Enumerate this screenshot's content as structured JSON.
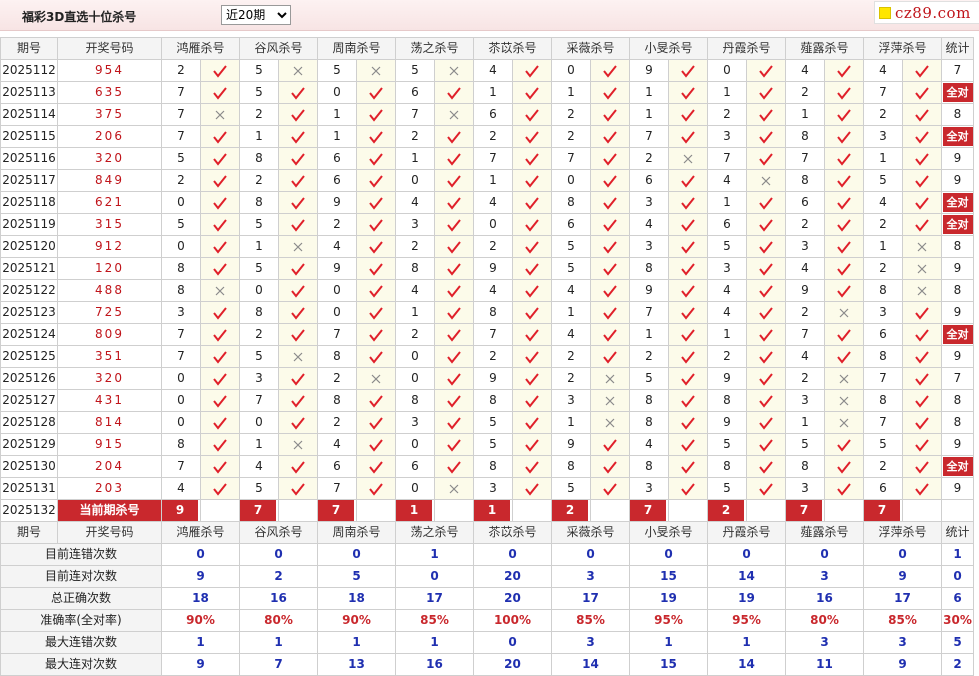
{
  "header": {
    "title": "福彩3D直选十位杀号",
    "period_selected": "近20期",
    "period_options": [
      "近20期"
    ],
    "logo_text": "cz89.com"
  },
  "columns": {
    "issue": "期号",
    "code": "开奖号码",
    "experts": [
      "鸿雁杀号",
      "谷风杀号",
      "周南杀号",
      "荡之杀号",
      "苶苡杀号",
      "采薇杀号",
      "小旻杀号",
      "丹霞杀号",
      "薤露杀号",
      "浮萍杀号"
    ],
    "total": "统计"
  },
  "rows": [
    {
      "issue": "2025112",
      "code": "954",
      "kills": [
        [
          2,
          1
        ],
        [
          5,
          0
        ],
        [
          5,
          0
        ],
        [
          5,
          0
        ],
        [
          4,
          1
        ],
        [
          0,
          1
        ],
        [
          9,
          1
        ],
        [
          0,
          1
        ],
        [
          4,
          1
        ],
        [
          4,
          1
        ]
      ],
      "total": "7"
    },
    {
      "issue": "2025113",
      "code": "635",
      "kills": [
        [
          7,
          1
        ],
        [
          5,
          1
        ],
        [
          0,
          1
        ],
        [
          6,
          1
        ],
        [
          1,
          1
        ],
        [
          1,
          1
        ],
        [
          1,
          1
        ],
        [
          1,
          1
        ],
        [
          2,
          1
        ],
        [
          7,
          1
        ]
      ],
      "total": "全对"
    },
    {
      "issue": "2025114",
      "code": "375",
      "kills": [
        [
          7,
          0
        ],
        [
          2,
          1
        ],
        [
          1,
          1
        ],
        [
          7,
          0
        ],
        [
          6,
          1
        ],
        [
          2,
          1
        ],
        [
          1,
          1
        ],
        [
          2,
          1
        ],
        [
          1,
          1
        ],
        [
          2,
          1
        ]
      ],
      "total": "8"
    },
    {
      "issue": "2025115",
      "code": "206",
      "kills": [
        [
          7,
          1
        ],
        [
          1,
          1
        ],
        [
          1,
          1
        ],
        [
          2,
          1
        ],
        [
          2,
          1
        ],
        [
          2,
          1
        ],
        [
          7,
          1
        ],
        [
          3,
          1
        ],
        [
          8,
          1
        ],
        [
          3,
          1
        ]
      ],
      "total": "全对"
    },
    {
      "issue": "2025116",
      "code": "320",
      "kills": [
        [
          5,
          1
        ],
        [
          8,
          1
        ],
        [
          6,
          1
        ],
        [
          1,
          1
        ],
        [
          7,
          1
        ],
        [
          7,
          1
        ],
        [
          2,
          0
        ],
        [
          7,
          1
        ],
        [
          7,
          1
        ],
        [
          1,
          1
        ]
      ],
      "total": "9"
    },
    {
      "issue": "2025117",
      "code": "849",
      "kills": [
        [
          2,
          1
        ],
        [
          2,
          1
        ],
        [
          6,
          1
        ],
        [
          0,
          1
        ],
        [
          1,
          1
        ],
        [
          0,
          1
        ],
        [
          6,
          1
        ],
        [
          4,
          0
        ],
        [
          8,
          1
        ],
        [
          5,
          1
        ]
      ],
      "total": "9"
    },
    {
      "issue": "2025118",
      "code": "621",
      "kills": [
        [
          0,
          1
        ],
        [
          8,
          1
        ],
        [
          9,
          1
        ],
        [
          4,
          1
        ],
        [
          4,
          1
        ],
        [
          8,
          1
        ],
        [
          3,
          1
        ],
        [
          1,
          1
        ],
        [
          6,
          1
        ],
        [
          4,
          1
        ]
      ],
      "total": "全对"
    },
    {
      "issue": "2025119",
      "code": "315",
      "kills": [
        [
          5,
          1
        ],
        [
          5,
          1
        ],
        [
          2,
          1
        ],
        [
          3,
          1
        ],
        [
          0,
          1
        ],
        [
          6,
          1
        ],
        [
          4,
          1
        ],
        [
          6,
          1
        ],
        [
          2,
          1
        ],
        [
          2,
          1
        ]
      ],
      "total": "全对"
    },
    {
      "issue": "2025120",
      "code": "912",
      "kills": [
        [
          0,
          1
        ],
        [
          1,
          0
        ],
        [
          4,
          1
        ],
        [
          2,
          1
        ],
        [
          2,
          1
        ],
        [
          5,
          1
        ],
        [
          3,
          1
        ],
        [
          5,
          1
        ],
        [
          3,
          1
        ],
        [
          1,
          0
        ]
      ],
      "total": "8"
    },
    {
      "issue": "2025121",
      "code": "120",
      "kills": [
        [
          8,
          1
        ],
        [
          5,
          1
        ],
        [
          9,
          1
        ],
        [
          8,
          1
        ],
        [
          9,
          1
        ],
        [
          5,
          1
        ],
        [
          8,
          1
        ],
        [
          3,
          1
        ],
        [
          4,
          1
        ],
        [
          2,
          0
        ]
      ],
      "total": "9"
    },
    {
      "issue": "2025122",
      "code": "488",
      "kills": [
        [
          8,
          0
        ],
        [
          0,
          1
        ],
        [
          0,
          1
        ],
        [
          4,
          1
        ],
        [
          4,
          1
        ],
        [
          4,
          1
        ],
        [
          9,
          1
        ],
        [
          4,
          1
        ],
        [
          9,
          1
        ],
        [
          8,
          0
        ]
      ],
      "total": "8"
    },
    {
      "issue": "2025123",
      "code": "725",
      "kills": [
        [
          3,
          1
        ],
        [
          8,
          1
        ],
        [
          0,
          1
        ],
        [
          1,
          1
        ],
        [
          8,
          1
        ],
        [
          1,
          1
        ],
        [
          7,
          1
        ],
        [
          4,
          1
        ],
        [
          2,
          0
        ],
        [
          3,
          1
        ]
      ],
      "total": "9"
    },
    {
      "issue": "2025124",
      "code": "809",
      "kills": [
        [
          7,
          1
        ],
        [
          2,
          1
        ],
        [
          7,
          1
        ],
        [
          2,
          1
        ],
        [
          7,
          1
        ],
        [
          4,
          1
        ],
        [
          1,
          1
        ],
        [
          1,
          1
        ],
        [
          7,
          1
        ],
        [
          6,
          1
        ]
      ],
      "total": "全对"
    },
    {
      "issue": "2025125",
      "code": "351",
      "kills": [
        [
          7,
          1
        ],
        [
          5,
          0
        ],
        [
          8,
          1
        ],
        [
          0,
          1
        ],
        [
          2,
          1
        ],
        [
          2,
          1
        ],
        [
          2,
          1
        ],
        [
          2,
          1
        ],
        [
          4,
          1
        ],
        [
          8,
          1
        ]
      ],
      "total": "9"
    },
    {
      "issue": "2025126",
      "code": "320",
      "kills": [
        [
          0,
          1
        ],
        [
          3,
          1
        ],
        [
          2,
          0
        ],
        [
          0,
          1
        ],
        [
          9,
          1
        ],
        [
          2,
          0
        ],
        [
          5,
          1
        ],
        [
          9,
          1
        ],
        [
          2,
          0
        ],
        [
          7,
          1
        ]
      ],
      "total": "7"
    },
    {
      "issue": "2025127",
      "code": "431",
      "kills": [
        [
          0,
          1
        ],
        [
          7,
          1
        ],
        [
          8,
          1
        ],
        [
          8,
          1
        ],
        [
          8,
          1
        ],
        [
          3,
          0
        ],
        [
          8,
          1
        ],
        [
          8,
          1
        ],
        [
          3,
          0
        ],
        [
          8,
          1
        ]
      ],
      "total": "8"
    },
    {
      "issue": "2025128",
      "code": "814",
      "kills": [
        [
          0,
          1
        ],
        [
          0,
          1
        ],
        [
          2,
          1
        ],
        [
          3,
          1
        ],
        [
          5,
          1
        ],
        [
          1,
          0
        ],
        [
          8,
          1
        ],
        [
          9,
          1
        ],
        [
          1,
          0
        ],
        [
          7,
          1
        ]
      ],
      "total": "8"
    },
    {
      "issue": "2025129",
      "code": "915",
      "kills": [
        [
          8,
          1
        ],
        [
          1,
          0
        ],
        [
          4,
          1
        ],
        [
          0,
          1
        ],
        [
          5,
          1
        ],
        [
          9,
          1
        ],
        [
          4,
          1
        ],
        [
          5,
          1
        ],
        [
          5,
          1
        ],
        [
          5,
          1
        ]
      ],
      "total": "9"
    },
    {
      "issue": "2025130",
      "code": "204",
      "kills": [
        [
          7,
          1
        ],
        [
          4,
          1
        ],
        [
          6,
          1
        ],
        [
          6,
          1
        ],
        [
          8,
          1
        ],
        [
          8,
          1
        ],
        [
          8,
          1
        ],
        [
          8,
          1
        ],
        [
          8,
          1
        ],
        [
          2,
          1
        ]
      ],
      "total": "全对"
    },
    {
      "issue": "2025131",
      "code": "203",
      "kills": [
        [
          4,
          1
        ],
        [
          5,
          1
        ],
        [
          7,
          1
        ],
        [
          0,
          0
        ],
        [
          3,
          1
        ],
        [
          5,
          1
        ],
        [
          3,
          1
        ],
        [
          5,
          1
        ],
        [
          3,
          1
        ],
        [
          6,
          1
        ]
      ],
      "total": "9"
    }
  ],
  "current": {
    "issue": "2025132",
    "label": "当前期杀号",
    "values": [
      "9",
      "7",
      "7",
      "1",
      "1",
      "2",
      "7",
      "2",
      "7",
      "7"
    ]
  },
  "stats": [
    {
      "label": "目前连错次数",
      "values": [
        "0",
        "0",
        "0",
        "1",
        "0",
        "0",
        "0",
        "0",
        "0",
        "0"
      ],
      "total": "1"
    },
    {
      "label": "目前连对次数",
      "values": [
        "9",
        "2",
        "5",
        "0",
        "20",
        "3",
        "15",
        "14",
        "3",
        "9"
      ],
      "total": "0"
    },
    {
      "label": "总正确次数",
      "values": [
        "18",
        "16",
        "18",
        "17",
        "20",
        "17",
        "19",
        "19",
        "16",
        "17"
      ],
      "total": "6"
    },
    {
      "label": "准确率(全对率)",
      "values": [
        "90%",
        "80%",
        "90%",
        "85%",
        "100%",
        "85%",
        "95%",
        "95%",
        "80%",
        "85%"
      ],
      "total": "30%"
    },
    {
      "label": "最大连错次数",
      "values": [
        "1",
        "1",
        "1",
        "1",
        "0",
        "3",
        "1",
        "1",
        "3",
        "3"
      ],
      "total": "5"
    },
    {
      "label": "最大连对次数",
      "values": [
        "9",
        "7",
        "13",
        "16",
        "20",
        "14",
        "15",
        "14",
        "11",
        "9"
      ],
      "total": "2"
    }
  ],
  "colors": {
    "accent": "#c9282d",
    "stat_blue": "#1f2fb0",
    "mark_bg": "#fcfbea"
  },
  "icons": {
    "correct": "check-icon",
    "wrong": "cross-icon"
  }
}
